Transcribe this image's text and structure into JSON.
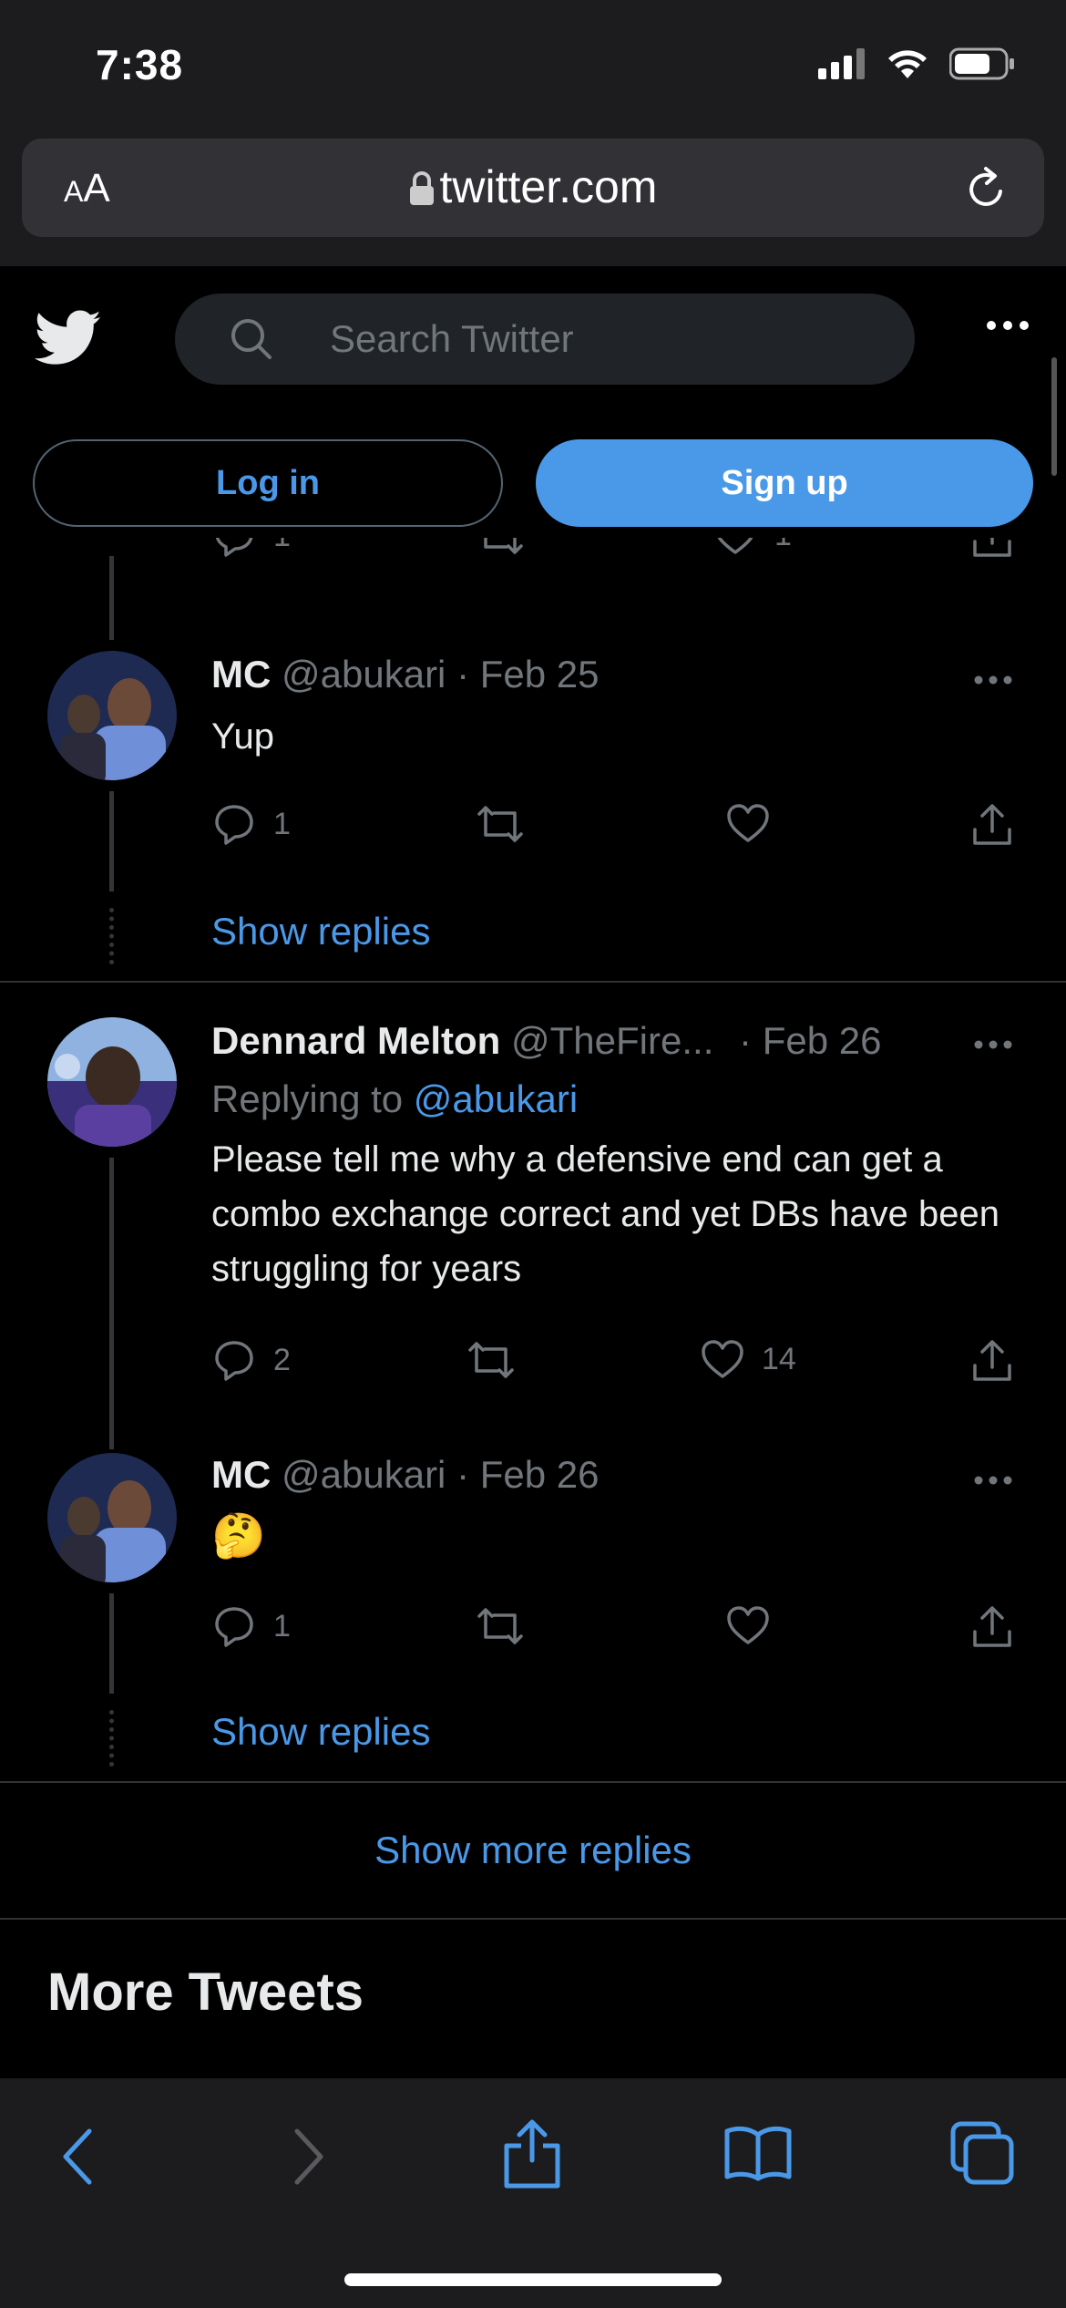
{
  "status_bar": {
    "time": "7:38"
  },
  "browser": {
    "aa_label": "AA",
    "url": "twitter.com"
  },
  "twitter_header": {
    "search_placeholder": "Search Twitter",
    "login_label": "Log in",
    "signup_label": "Sign up"
  },
  "partial_tweet": {
    "reply_count": "1",
    "like_count": "1"
  },
  "tweets": [
    {
      "name": "MC",
      "handle": "@abukari",
      "date": "· Feb 25",
      "text": "Yup",
      "replies": "1",
      "retweets": "",
      "likes": "",
      "show_replies": "Show replies"
    },
    {
      "name": "Dennard Melton",
      "handle": "@TheFire...",
      "date": "· Feb 26",
      "replying_prefix": "Replying to",
      "replying_to": "@abukari",
      "text": "Please tell me why a defensive end can get a combo exchange correct and yet DBs have been struggling for years",
      "replies": "2",
      "retweets": "",
      "likes": "14"
    },
    {
      "name": "MC",
      "handle": "@abukari",
      "date": "· Feb 26",
      "text": "🤔",
      "replies": "1",
      "retweets": "",
      "likes": "",
      "show_replies": "Show replies"
    }
  ],
  "show_more_replies": "Show more replies",
  "more_tweets": "More Tweets",
  "colors": {
    "accent": "#4a99e9",
    "background": "#000000",
    "muted": "#71767b",
    "bar": "#1c1c1e"
  }
}
